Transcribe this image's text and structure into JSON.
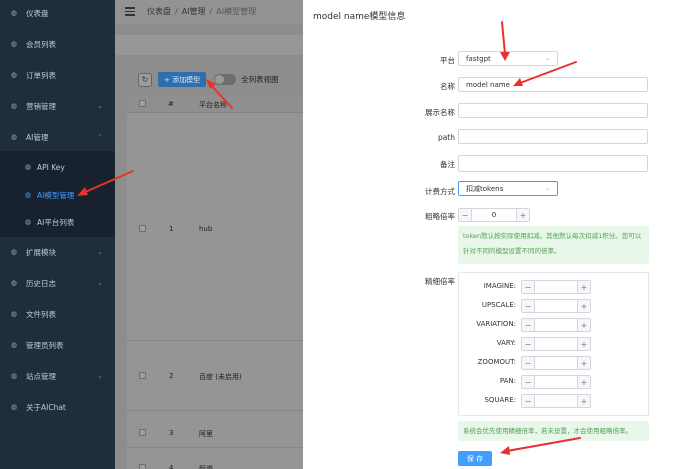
{
  "sidebar": {
    "items": [
      {
        "label": "仪表盘",
        "icon": "gauge-icon",
        "chevron": false
      },
      {
        "label": "会员列表",
        "icon": "gauge-icon",
        "chevron": false
      },
      {
        "label": "订单列表",
        "icon": "gauge-icon",
        "chevron": false
      },
      {
        "label": "营销管理",
        "icon": "gauge-icon",
        "chevron": true
      },
      {
        "label": "AI管理",
        "icon": "gauge-icon",
        "chevron": true
      },
      {
        "label": "API Key",
        "icon": "gauge-icon",
        "sub": true
      },
      {
        "label": "AI模型管理",
        "icon": "gauge-icon",
        "sub": true,
        "active": true
      },
      {
        "label": "AI平台列表",
        "icon": "gauge-icon",
        "sub": true
      },
      {
        "label": "扩展模块",
        "icon": "gauge-icon",
        "chevron": true
      },
      {
        "label": "历史日志",
        "icon": "gauge-icon",
        "chevron": true
      },
      {
        "label": "文件列表",
        "icon": "gauge-icon",
        "chevron": false
      },
      {
        "label": "管理员列表",
        "icon": "gauge-icon",
        "chevron": false
      },
      {
        "label": "站点管理",
        "icon": "gauge-icon",
        "chevron": true
      },
      {
        "label": "关于AIChat",
        "icon": "gauge-icon",
        "chevron": false
      }
    ]
  },
  "header": {
    "breadcrumb": [
      "仪表盘",
      "AI管理",
      "AI模型管理"
    ]
  },
  "toolbar": {
    "refresh_icon": "↻",
    "add_label": "+ 添加模型",
    "toggle_label": "全列表视图"
  },
  "table": {
    "headers": {
      "index": "#",
      "platform": "平台名称"
    },
    "rows": [
      {
        "index": "1",
        "platform": "hub"
      },
      {
        "index": "2",
        "platform": "百度 (未启用)"
      },
      {
        "index": "3",
        "platform": "阿里"
      },
      {
        "index": "4",
        "platform": "智谱"
      }
    ]
  },
  "drawer": {
    "title": "model name模型信息",
    "platform": {
      "label": "平台",
      "value": "fastgpt"
    },
    "name": {
      "label": "名称",
      "value": "model name"
    },
    "display_name": {
      "label": "展示名称",
      "value": ""
    },
    "path": {
      "label": "path",
      "value": ""
    },
    "remark": {
      "label": "备注",
      "value": ""
    },
    "billing": {
      "label": "计费方式",
      "value": "扣减tokens"
    },
    "rough_rate": {
      "label": "粗略倍率",
      "value": "0",
      "minus": "−",
      "plus": "+"
    },
    "rough_hint": "token默认按实际使用扣减，其他默认每次扣减1积分。您可以针对不同的模型设置不同的倍率。",
    "fine_rate": {
      "label": "精细倍率",
      "items": [
        "IMAGINE:",
        "UPSCALE:",
        "VARIATION:",
        "VARY:",
        "ZOOMOUT:",
        "PAN:",
        "SQUARE:"
      ]
    },
    "fine_hint": "系统会优先使用精细倍率，若未设置，才会使用粗略倍率。",
    "save_label": "保 存"
  },
  "colors": {
    "sidebar_bg": "#1f2d3d",
    "accent": "#409eff",
    "annotation_arrow": "#e8322d",
    "hint_bg": "#e9f7ea",
    "hint_text": "#53a052"
  }
}
